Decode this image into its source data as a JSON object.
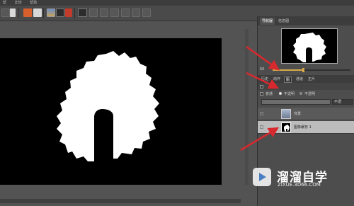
{
  "menu": {
    "items": [
      "帮",
      "比较",
      "帮助"
    ]
  },
  "toolbar": {
    "tools": [
      "save-icon",
      "selection-icon",
      "document-icon",
      "image-icon",
      "image-icon",
      "filmstrip-icon",
      "grid-icon"
    ]
  },
  "panel": {
    "tabs": [
      "导航器",
      "信息图"
    ],
    "zoom_label": "60",
    "zoom_level": 0.38,
    "tabs2": [
      "历史",
      "动作",
      "图",
      "通道",
      "正片"
    ],
    "radio": {
      "option1": "普通",
      "option2": "不透明",
      "option3": "不透明"
    },
    "field_select": "不透",
    "layers": [
      {
        "name": "背景"
      },
      {
        "name": "图像缓存 1"
      }
    ]
  },
  "watermark": {
    "title": "溜溜自学",
    "subtitle": "ZIXUE.3D66.COM"
  },
  "colors": {
    "accent": "#d8a94a",
    "arrow": "#d8292e",
    "canvas": "#000000",
    "background": "#535353"
  }
}
